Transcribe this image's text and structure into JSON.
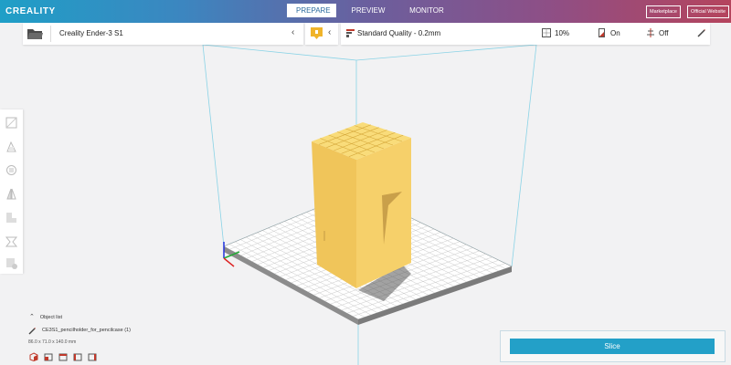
{
  "app": {
    "logo_text": "CREALITY"
  },
  "header": {
    "tabs": [
      {
        "label": "PREPARE",
        "active": true
      },
      {
        "label": "PREVIEW",
        "active": false
      },
      {
        "label": "MONITOR",
        "active": false
      }
    ],
    "buttons": {
      "marketplace": "Marketplace",
      "official_website": "Official Website"
    }
  },
  "toolbar": {
    "printer_name": "Creality Ender-3 S1",
    "quality": "Standard Quality - 0.2mm",
    "infill": "10%",
    "support": "On",
    "adhesion": "Off"
  },
  "object_panel": {
    "title": "Object list",
    "object_name": "CE3S1_pencilholder_for_pencilcase (1)",
    "dimensions": "86.0 x 71.0 x 140.0 mm"
  },
  "slice": {
    "label": "Slice"
  },
  "colors": {
    "accent": "#23a0c8",
    "model": "#f4cc5c",
    "bed_grid": "#c8c8c8",
    "frame": "#7fd0e6"
  }
}
